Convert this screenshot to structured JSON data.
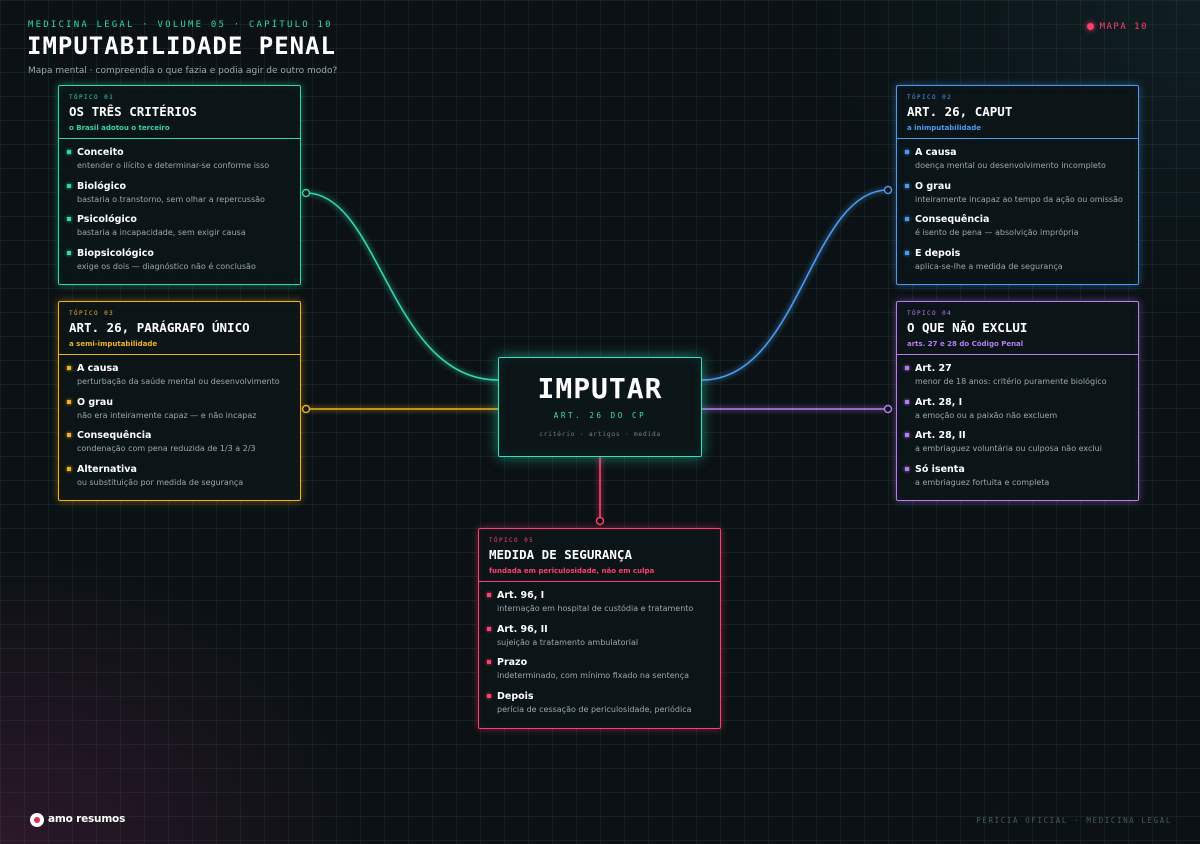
{
  "header": {
    "kicker": "MEDICINA LEGAL · VOLUME 05 · CAPÍTULO 10",
    "title": "IMPUTABILIDADE PENAL",
    "subtitle": "Mapa mental · compreendia o que fazia e podia agir de outro modo?",
    "map_label": "MAPA 10"
  },
  "center": {
    "title": "IMPUTAR",
    "subtitle": "ART. 26 DO CP",
    "tags": "critério · artigos · medida"
  },
  "colors": {
    "teal": "#2fd6ae",
    "blue": "#4a9bf0",
    "amber": "#f2b01e",
    "violet": "#b77cf2",
    "pink": "#ff3d6e"
  },
  "topics": [
    {
      "tag": "TÓPICO 01",
      "title": "OS TRÊS CRITÉRIOS",
      "caption": "o Brasil adotou o terceiro",
      "items": [
        {
          "label": "Conceito",
          "desc": "entender o ilícito e determinar-se conforme isso"
        },
        {
          "label": "Biológico",
          "desc": "bastaria o transtorno, sem olhar a repercussão"
        },
        {
          "label": "Psicológico",
          "desc": "bastaria a incapacidade, sem exigir causa"
        },
        {
          "label": "Biopsicológico",
          "desc": "exige os dois — diagnóstico não é conclusão"
        }
      ]
    },
    {
      "tag": "TÓPICO 02",
      "title": "ART. 26, CAPUT",
      "caption": "a inimputabilidade",
      "items": [
        {
          "label": "A causa",
          "desc": "doença mental ou desenvolvimento incompleto"
        },
        {
          "label": "O grau",
          "desc": "inteiramente incapaz ao tempo da ação ou omissão"
        },
        {
          "label": "Consequência",
          "desc": "é isento de pena — absolvição imprópria"
        },
        {
          "label": "E depois",
          "desc": "aplica-se-lhe a medida de segurança"
        }
      ]
    },
    {
      "tag": "TÓPICO 03",
      "title": "ART. 26, PARÁGRAFO ÚNICO",
      "caption": "a semi-imputabilidade",
      "items": [
        {
          "label": "A causa",
          "desc": "perturbação da saúde mental ou desenvolvimento"
        },
        {
          "label": "O grau",
          "desc": "não era inteiramente capaz — e não incapaz"
        },
        {
          "label": "Consequência",
          "desc": "condenação com pena reduzida de 1/3 a 2/3"
        },
        {
          "label": "Alternativa",
          "desc": "ou substituição por medida de segurança"
        }
      ]
    },
    {
      "tag": "TÓPICO 04",
      "title": "O QUE NÃO EXCLUI",
      "caption": "arts. 27 e 28 do Código Penal",
      "items": [
        {
          "label": "Art. 27",
          "desc": "menor de 18 anos: critério puramente biológico"
        },
        {
          "label": "Art. 28, I",
          "desc": "a emoção ou a paixão não excluem"
        },
        {
          "label": "Art. 28, II",
          "desc": "a embriaguez voluntária ou culposa não exclui"
        },
        {
          "label": "Só isenta",
          "desc": "a embriaguez fortuita e completa"
        }
      ]
    },
    {
      "tag": "TÓPICO 05",
      "title": "MEDIDA DE SEGURANÇA",
      "caption": "fundada em periculosidade, não em culpa",
      "items": [
        {
          "label": "Art. 96, I",
          "desc": "internação em hospital de custódia e tratamento"
        },
        {
          "label": "Art. 96, II",
          "desc": "sujeição a tratamento ambulatorial"
        },
        {
          "label": "Prazo",
          "desc": "indeterminado, com mínimo fixado na sentença"
        },
        {
          "label": "Depois",
          "desc": "perícia de cessação de periculosidade, periódica"
        }
      ]
    }
  ],
  "footer": {
    "logo_text": "amo resumos",
    "note": "PERÍCIA OFICIAL · MEDICINA LEGAL"
  }
}
